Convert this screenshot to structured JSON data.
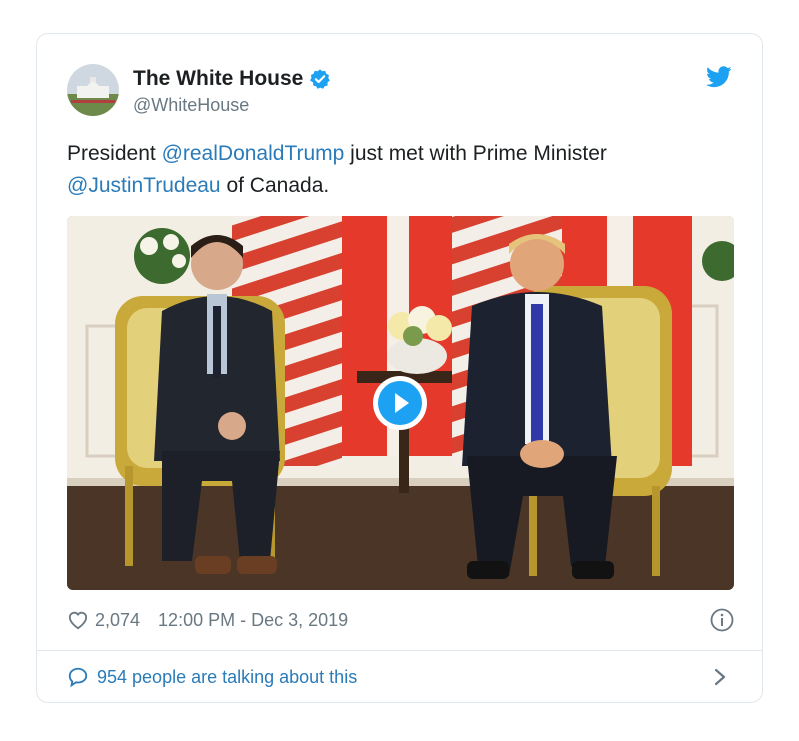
{
  "account": {
    "name": "The White House",
    "handle": "@WhiteHouse"
  },
  "tweet": {
    "text_prefix": "President ",
    "mention1": "@realDonaldTrump",
    "text_middle": " just met with Prime Minister ",
    "mention2": "@JustinTrudeau",
    "text_suffix": " of Canada."
  },
  "footer": {
    "likes": "2,074",
    "timestamp": "12:00 PM - Dec 3, 2019",
    "talking": "954 people are talking about this"
  },
  "icons": {
    "verified": "verified-badge-icon",
    "brand": "twitter-bird-icon",
    "like": "heart-icon",
    "info": "info-icon",
    "reply": "speech-bubble-icon",
    "more": "chevron-right-icon",
    "play": "play-icon"
  },
  "colors": {
    "link": "#2b7bb9",
    "verified": "#1da1f2",
    "muted": "#697882",
    "border": "#e1e8ed"
  }
}
